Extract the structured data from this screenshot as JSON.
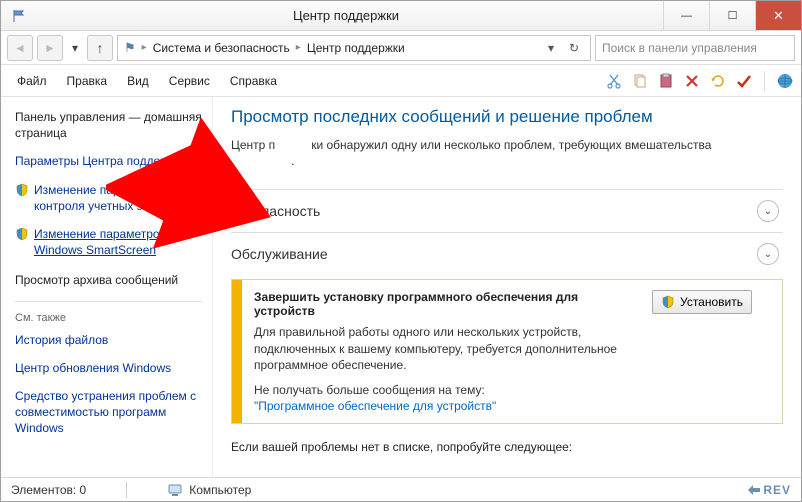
{
  "window": {
    "title": "Центр поддержки"
  },
  "nav": {
    "breadcrumb": [
      "Система и безопасность",
      "Центр поддержки"
    ],
    "search_placeholder": "Поиск в панели управления"
  },
  "menu": {
    "file": "Файл",
    "edit": "Правка",
    "view": "Вид",
    "service": "Сервис",
    "help": "Справка"
  },
  "sidebar": {
    "items": [
      {
        "label": "Панель управления — домашняя страница"
      },
      {
        "label": "Параметры Центра поддержки"
      },
      {
        "label": "Изменение параметров контроля учетных записей"
      },
      {
        "label": "Изменение параметров Windows SmartScreen"
      },
      {
        "label": "Просмотр архива сообщений"
      }
    ],
    "seealso_header": "См. также",
    "seealso": [
      {
        "label": "История файлов"
      },
      {
        "label": "Центр обновления Windows"
      },
      {
        "label": "Средство устранения проблем с совместимостью программ Windows"
      }
    ]
  },
  "main": {
    "heading": "Просмотр последних сообщений и решение проблем",
    "subtext_prefix": "Центр п",
    "subtext_suffix": "ки обнаружил одну или несколько проблем, требующих вмешательства",
    "subtext_dot": ".",
    "section_security": "пасность",
    "section_maint": "Обслуживание",
    "alert": {
      "title": "Завершить установку программного обеспечения для устройств",
      "desc": "Для правильной работы одного или нескольких устройств, подключенных к вашему компьютеру, требуется дополнительное программное обеспечение.",
      "link_label": "Не получать больше сообщения на тему:",
      "link_text": "\"Программное обеспечение для устройств\"",
      "install_btn": "Установить"
    },
    "footer": "Если вашей проблемы нет в списке, попробуйте следующее:"
  },
  "statusbar": {
    "elements": "Элементов: 0",
    "computer": "Компьютер",
    "brand": "REV"
  }
}
